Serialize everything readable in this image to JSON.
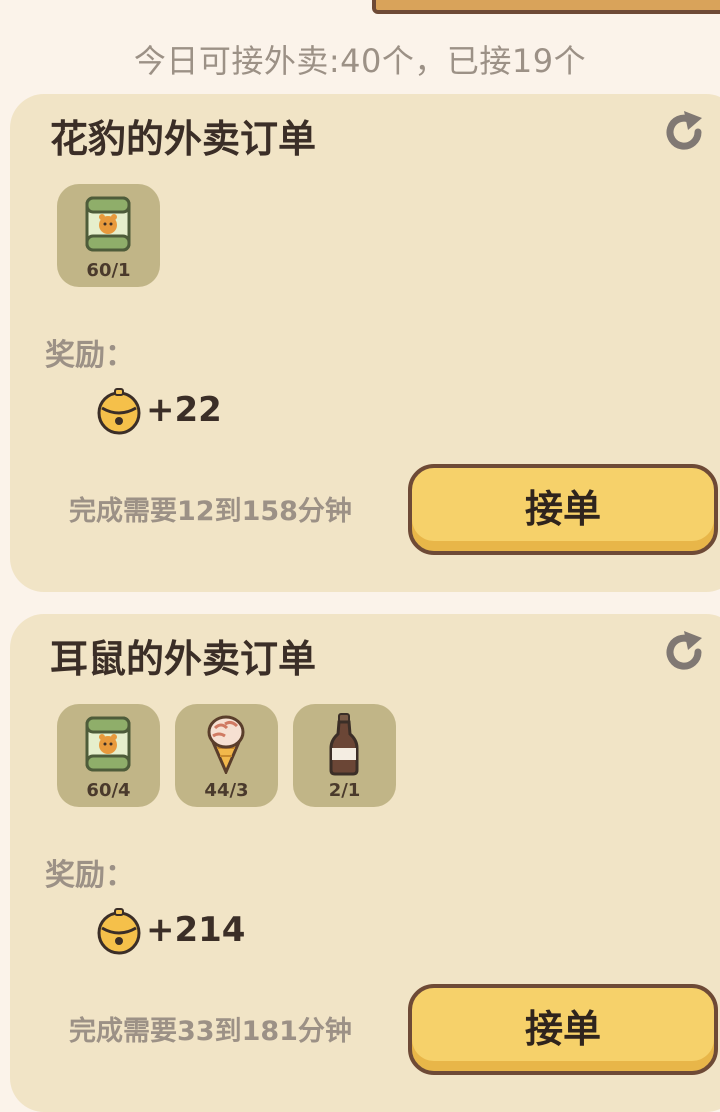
{
  "daily_status": "今日可接外卖:40个，已接19个",
  "orders": [
    {
      "title": "花豹的外卖订单",
      "items": [
        {
          "icon": "canned-food-icon",
          "count": "60/1"
        }
      ],
      "reward_label": "奖励：",
      "reward_icon": "bell-icon",
      "reward_value": "+22",
      "time_text": "完成需要12到158分钟",
      "accept_label": "接单"
    },
    {
      "title": "耳鼠的外卖订单",
      "items": [
        {
          "icon": "canned-food-icon",
          "count": "60/4"
        },
        {
          "icon": "ice-cream-cone-icon",
          "count": "44/3"
        },
        {
          "icon": "bottle-icon",
          "count": "2/1"
        }
      ],
      "reward_label": "奖励：",
      "reward_icon": "bell-icon",
      "reward_value": "+214",
      "time_text": "完成需要33到181分钟",
      "accept_label": "接单"
    }
  ],
  "colors": {
    "background": "#fbf3ea",
    "card": "#f1e4c6",
    "item_tile": "#c1b587",
    "button": "#f6d16a",
    "button_border": "#6e4a36"
  }
}
